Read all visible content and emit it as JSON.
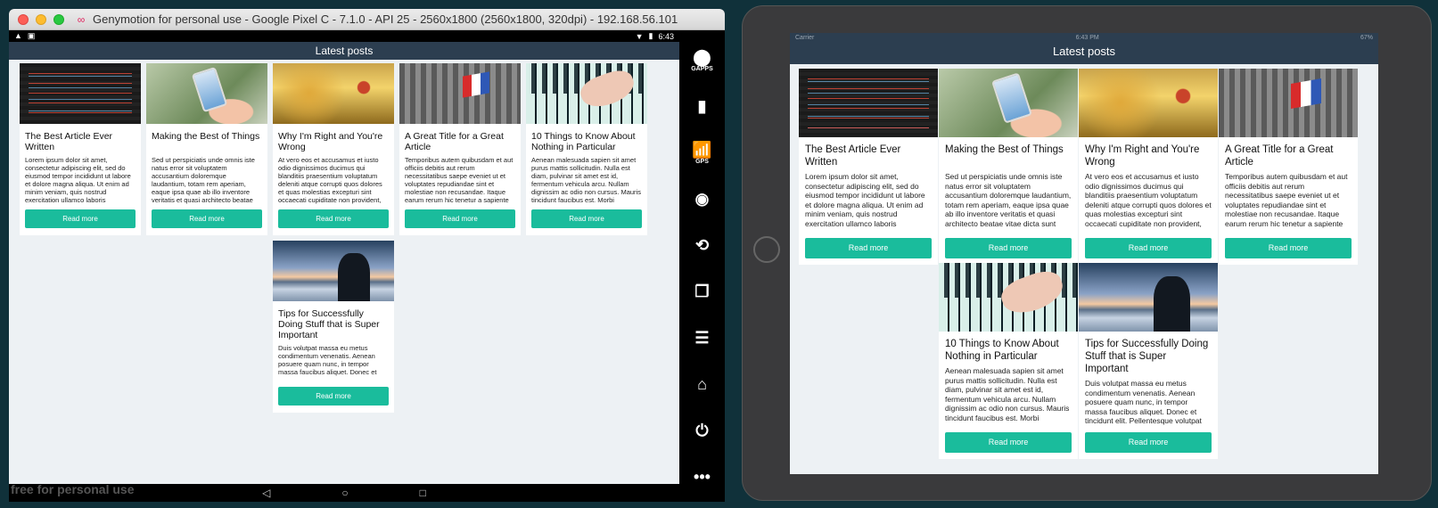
{
  "genymotion": {
    "window_title": "Genymotion for personal use - Google Pixel C - 7.1.0 - API 25 - 2560x1800 (2560x1800, 320dpi) - 192.168.56.101",
    "status_time": "6:43",
    "watermark": "free for personal use",
    "sidebar": [
      {
        "name": "gapps",
        "glyph": "⬤",
        "label": "GAPPS"
      },
      {
        "name": "battery",
        "glyph": "▮",
        "label": ""
      },
      {
        "name": "gps",
        "glyph": "📶",
        "label": "GPS"
      },
      {
        "name": "webcam",
        "glyph": "◉",
        "label": ""
      },
      {
        "name": "back",
        "glyph": "⟲",
        "label": ""
      },
      {
        "name": "recent-apps",
        "glyph": "❐",
        "label": ""
      },
      {
        "name": "menu",
        "glyph": "☰",
        "label": ""
      },
      {
        "name": "home",
        "glyph": "⌂",
        "label": ""
      },
      {
        "name": "power",
        "glyph": "⏻",
        "label": ""
      },
      {
        "name": "more",
        "glyph": "•••",
        "label": ""
      }
    ],
    "nav": {
      "back": "◁",
      "home": "○",
      "recent": "□"
    }
  },
  "app": {
    "header_title": "Latest posts",
    "read_more": "Read more"
  },
  "ios": {
    "carrier": "Carrier",
    "time": "6:43 PM",
    "battery": "67%"
  },
  "posts": [
    {
      "title": "The Best Article Ever Written",
      "excerpt": "Lorem ipsum dolor sit amet, consectetur adipiscing elit, sed do eiusmod tempor incididunt ut labore et dolore magna aliqua. Ut enim ad minim veniam, quis nostrud exercitation ullamco laboris",
      "image": "code"
    },
    {
      "title": "Making the Best of Things",
      "excerpt": "Sed ut perspiciatis unde omnis iste natus error sit voluptatem accusantium doloremque laudantium, totam rem aperiam, eaque ipsa quae ab illo inventore veritatis et quasi architecto beatae vitae dicta sunt explicabo. Nemo enim ipsam voluptatem",
      "image": "phone"
    },
    {
      "title": "Why I'm Right and You're Wrong",
      "excerpt": "At vero eos et accusamus et iusto odio dignissimos ducimus qui blanditiis praesentium voluptatum deleniti atque corrupti quos dolores et quas molestias excepturi sint occaecati cupiditate non provident,",
      "image": "gold"
    },
    {
      "title": "A Great Title for a Great Article",
      "excerpt": "Temporibus autem quibusdam et aut officiis debitis aut rerum necessitatibus saepe eveniet ut et voluptates repudiandae sint et molestiae non recusandae. Itaque earum rerum hic tenetur a sapiente",
      "image": "flag"
    },
    {
      "title": "10 Things to Know About Nothing in Particular",
      "excerpt": "Aenean malesuada sapien sit amet purus mattis sollicitudin. Nulla est diam, pulvinar sit amet est id, fermentum vehicula arcu. Nullam dignissim ac odio non cursus. Mauris tincidunt faucibus est. Morbi",
      "image": "piano"
    },
    {
      "title": "Tips for Successfully Doing Stuff that is Super Important",
      "excerpt": "Duis volutpat massa eu metus condimentum venenatis. Aenean posuere quam nunc, in tempor massa faucibus aliquet. Donec et tincidunt elit. Pellentesque volutpat",
      "image": "sunset"
    }
  ]
}
